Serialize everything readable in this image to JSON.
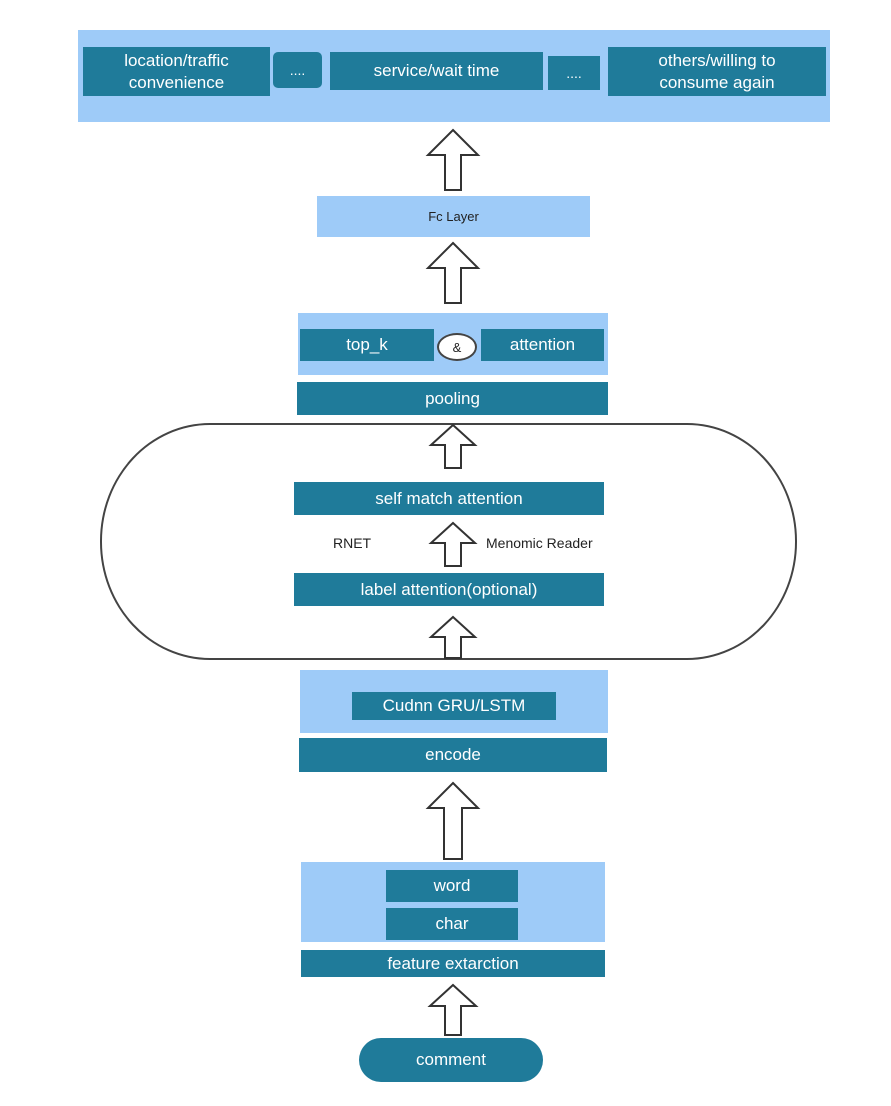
{
  "output_layer": {
    "items": [
      "location/traffic\nconvenience",
      "....",
      "service/wait time",
      "....",
      "others/willing to\nconsume again"
    ]
  },
  "fc_layer": "Fc Layer",
  "combine": {
    "left": "top_k",
    "operator": "&",
    "right": "attention"
  },
  "pooling": "pooling",
  "reader_block": {
    "self_match": "self match attention",
    "left_label": "RNET",
    "right_label": "Menomic Reader",
    "label_attention": "label attention(optional)"
  },
  "encoder": {
    "rnn": "Cudnn GRU/LSTM",
    "encode": "encode"
  },
  "features": {
    "word": "word",
    "char": "char",
    "extraction": "feature extarction"
  },
  "input": "comment",
  "colors": {
    "dark_box": "#1f7b9a",
    "light_container": "#9ecbf8",
    "arrow_fill": "#ffffff",
    "arrow_stroke": "#333333"
  }
}
